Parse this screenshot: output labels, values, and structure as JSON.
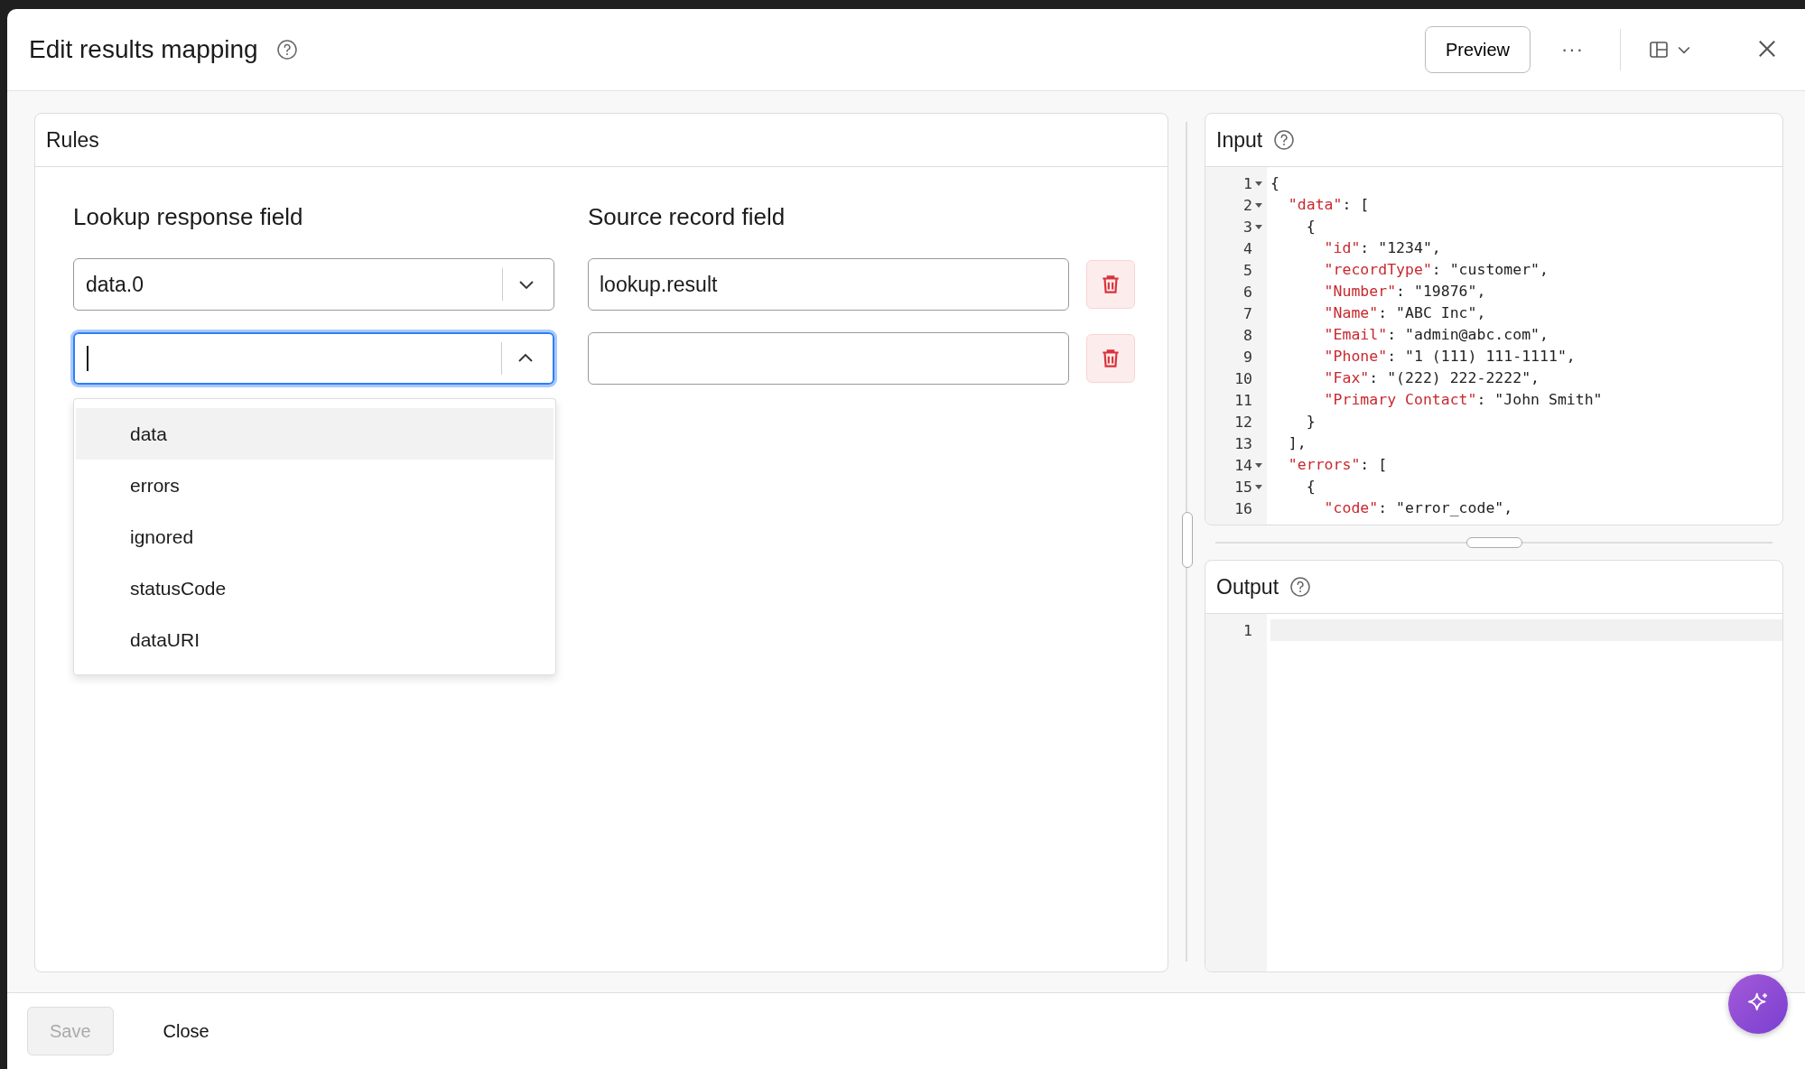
{
  "window": {
    "title": "Edit results mapping"
  },
  "header_buttons": [
    {
      "kind": "text",
      "label": "Preview"
    },
    {
      "kind": "more",
      "label": "···"
    }
  ],
  "rules": {
    "title": "Rules",
    "columns": [
      "Lookup response field",
      "Source record field"
    ],
    "rows": [
      {
        "lookup": {
          "value": "data.0",
          "expanded": false,
          "focused": false
        },
        "source": {
          "value": "lookup.result"
        }
      },
      {
        "lookup": {
          "expanded": true,
          "focused": true
        },
        "source": {}
      }
    ],
    "dropdown": [
      {
        "label": "data",
        "highlighted": true
      },
      {
        "label": "errors",
        "highlighted": false
      },
      {
        "label": "ignored",
        "highlighted": false
      },
      {
        "label": "statusCode",
        "highlighted": false
      },
      {
        "label": "dataURI",
        "highlighted": false
      }
    ]
  },
  "input": {
    "title": "Input",
    "lines": [
      {
        "number": "1",
        "foldable": true,
        "tokens": [
          {
            "kind": "punct",
            "text": "{"
          }
        ]
      },
      {
        "number": "2",
        "foldable": true,
        "tokens": [
          {
            "kind": "key",
            "text": "  \"data\""
          },
          {
            "kind": "punct",
            "text": ": ["
          }
        ]
      },
      {
        "number": "3",
        "foldable": true,
        "tokens": [
          {
            "kind": "punct",
            "text": "    {"
          }
        ]
      },
      {
        "number": "4",
        "foldable": false,
        "tokens": [
          {
            "kind": "key",
            "text": "      \"id\""
          },
          {
            "kind": "punct",
            "text": ": \"1234\","
          }
        ]
      },
      {
        "number": "5",
        "foldable": false,
        "tokens": [
          {
            "kind": "key",
            "text": "      \"recordType\""
          },
          {
            "kind": "punct",
            "text": ": \"customer\","
          }
        ]
      },
      {
        "number": "6",
        "foldable": false,
        "tokens": [
          {
            "kind": "key",
            "text": "      \"Number\""
          },
          {
            "kind": "punct",
            "text": ": \"19876\","
          }
        ]
      },
      {
        "number": "7",
        "foldable": false,
        "tokens": [
          {
            "kind": "key",
            "text": "      \"Name\""
          },
          {
            "kind": "punct",
            "text": ": \"ABC Inc\","
          }
        ]
      },
      {
        "number": "8",
        "foldable": false,
        "tokens": [
          {
            "kind": "key",
            "text": "      \"Email\""
          },
          {
            "kind": "punct",
            "text": ": \"admin@abc.com\","
          }
        ]
      },
      {
        "number": "9",
        "foldable": false,
        "tokens": [
          {
            "kind": "key",
            "text": "      \"Phone\""
          },
          {
            "kind": "punct",
            "text": ": \"1 (111) 111-1111\","
          }
        ]
      },
      {
        "number": "10",
        "foldable": false,
        "tokens": [
          {
            "kind": "key",
            "text": "      \"Fax\""
          },
          {
            "kind": "punct",
            "text": ": \"(222) 222-2222\","
          }
        ]
      },
      {
        "number": "11",
        "foldable": false,
        "tokens": [
          {
            "kind": "key",
            "text": "      \"Primary Contact\""
          },
          {
            "kind": "punct",
            "text": ": \"John Smith\""
          }
        ]
      },
      {
        "number": "12",
        "foldable": false,
        "tokens": [
          {
            "kind": "punct",
            "text": "    }"
          }
        ]
      },
      {
        "number": "13",
        "foldable": false,
        "tokens": [
          {
            "kind": "punct",
            "text": "  ],"
          }
        ]
      },
      {
        "number": "14",
        "foldable": true,
        "tokens": [
          {
            "kind": "key",
            "text": "  \"errors\""
          },
          {
            "kind": "punct",
            "text": ": ["
          }
        ]
      },
      {
        "number": "15",
        "foldable": true,
        "tokens": [
          {
            "kind": "punct",
            "text": "    {"
          }
        ]
      },
      {
        "number": "16",
        "foldable": false,
        "tokens": [
          {
            "kind": "key",
            "text": "      \"code\""
          },
          {
            "kind": "punct",
            "text": ": \"error_code\","
          }
        ]
      }
    ]
  },
  "output": {
    "title": "Output",
    "lines": [
      {
        "number": "1"
      }
    ]
  },
  "footer": {
    "buttons": [
      {
        "label": "Save",
        "disabled": true
      },
      {
        "label": "Close",
        "disabled": false
      }
    ]
  }
}
